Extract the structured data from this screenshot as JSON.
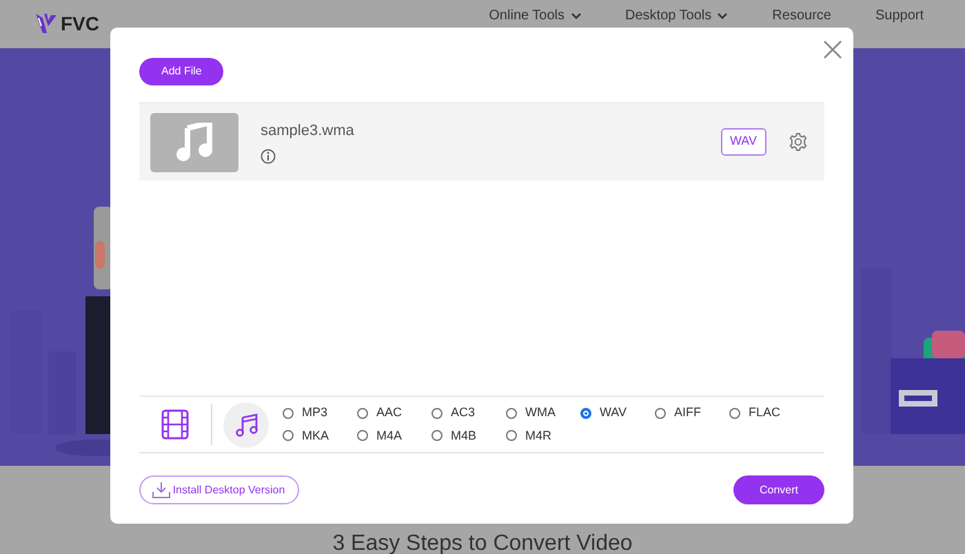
{
  "page": {
    "logo": "FVC",
    "nav": [
      {
        "label": "Online Tools",
        "dropdown": true
      },
      {
        "label": "Desktop Tools",
        "dropdown": true
      },
      {
        "label": "Resource",
        "dropdown": false
      },
      {
        "label": "Support",
        "dropdown": false
      }
    ],
    "heading": "3 Easy Steps to Convert Video"
  },
  "dialog": {
    "add_button": "Add File",
    "files": [
      {
        "name": "sample3.wma",
        "format": "WAV"
      }
    ],
    "categories": [
      {
        "kind": "video",
        "selected": false
      },
      {
        "kind": "audio",
        "selected": true
      }
    ],
    "formats": [
      {
        "label": "MP3",
        "selected": false
      },
      {
        "label": "AAC",
        "selected": false
      },
      {
        "label": "AC3",
        "selected": false
      },
      {
        "label": "WMA",
        "selected": false
      },
      {
        "label": "WAV",
        "selected": true
      },
      {
        "label": "AIFF",
        "selected": false
      },
      {
        "label": "FLAC",
        "selected": false
      },
      {
        "label": "MKA",
        "selected": false
      },
      {
        "label": "M4A",
        "selected": false
      },
      {
        "label": "M4B",
        "selected": false
      },
      {
        "label": "M4R",
        "selected": false
      }
    ],
    "install_button": "Install Desktop Version",
    "convert_button": "Convert"
  }
}
